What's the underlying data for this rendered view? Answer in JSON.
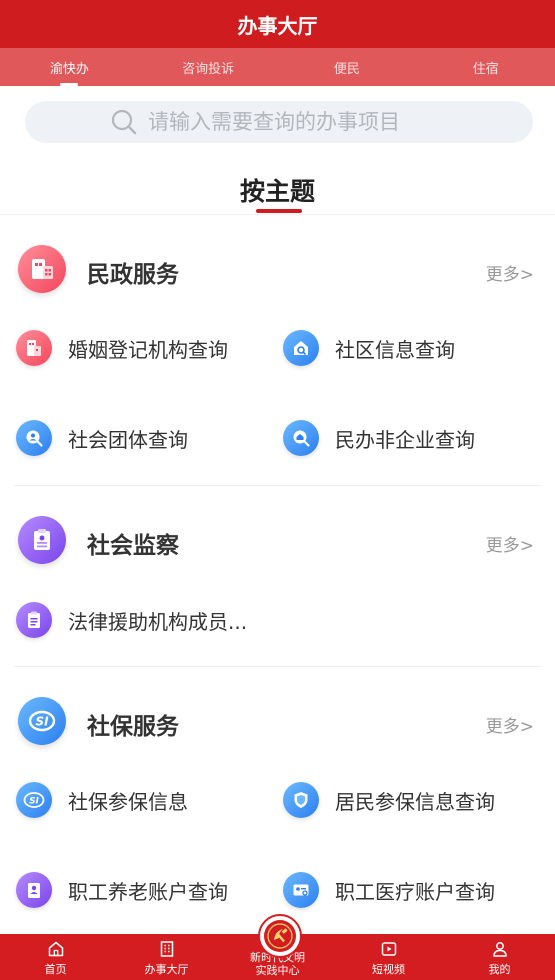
{
  "header": {
    "title": "办事大厅"
  },
  "tabs": [
    {
      "label": "渝快办",
      "active": true
    },
    {
      "label": "咨询投诉",
      "active": false
    },
    {
      "label": "便民",
      "active": false
    },
    {
      "label": "住宿",
      "active": false
    }
  ],
  "search": {
    "placeholder": "请输入需要查询的办事项目"
  },
  "theme": {
    "title": "按主题"
  },
  "sections": {
    "civil": {
      "title": "民政服务",
      "more": "更多>",
      "items": [
        "婚姻登记机构查询",
        "社区信息查询",
        "社会团体查询",
        "民办非企业查询"
      ]
    },
    "supervision": {
      "title": "社会监察",
      "more": "更多>",
      "items": [
        "法律援助机构成员..."
      ]
    },
    "social_security": {
      "title": "社保服务",
      "more": "更多>",
      "items": [
        "社保参保信息",
        "居民参保信息查询",
        "职工养老账户查询",
        "职工医疗账户查询"
      ]
    }
  },
  "bottom_nav": [
    {
      "label": "首页",
      "icon": "home-icon"
    },
    {
      "label": "办事大厅",
      "icon": "building-icon"
    },
    {
      "label": "新时代文明",
      "label2": "实践中心",
      "icon": "party-emblem-icon"
    },
    {
      "label": "短视频",
      "icon": "video-icon"
    },
    {
      "label": "我的",
      "icon": "user-icon"
    }
  ],
  "colors": {
    "brand_red": "#cf1c1f",
    "tab_bar": "#e1585b",
    "search_bg": "#eef2f6"
  }
}
